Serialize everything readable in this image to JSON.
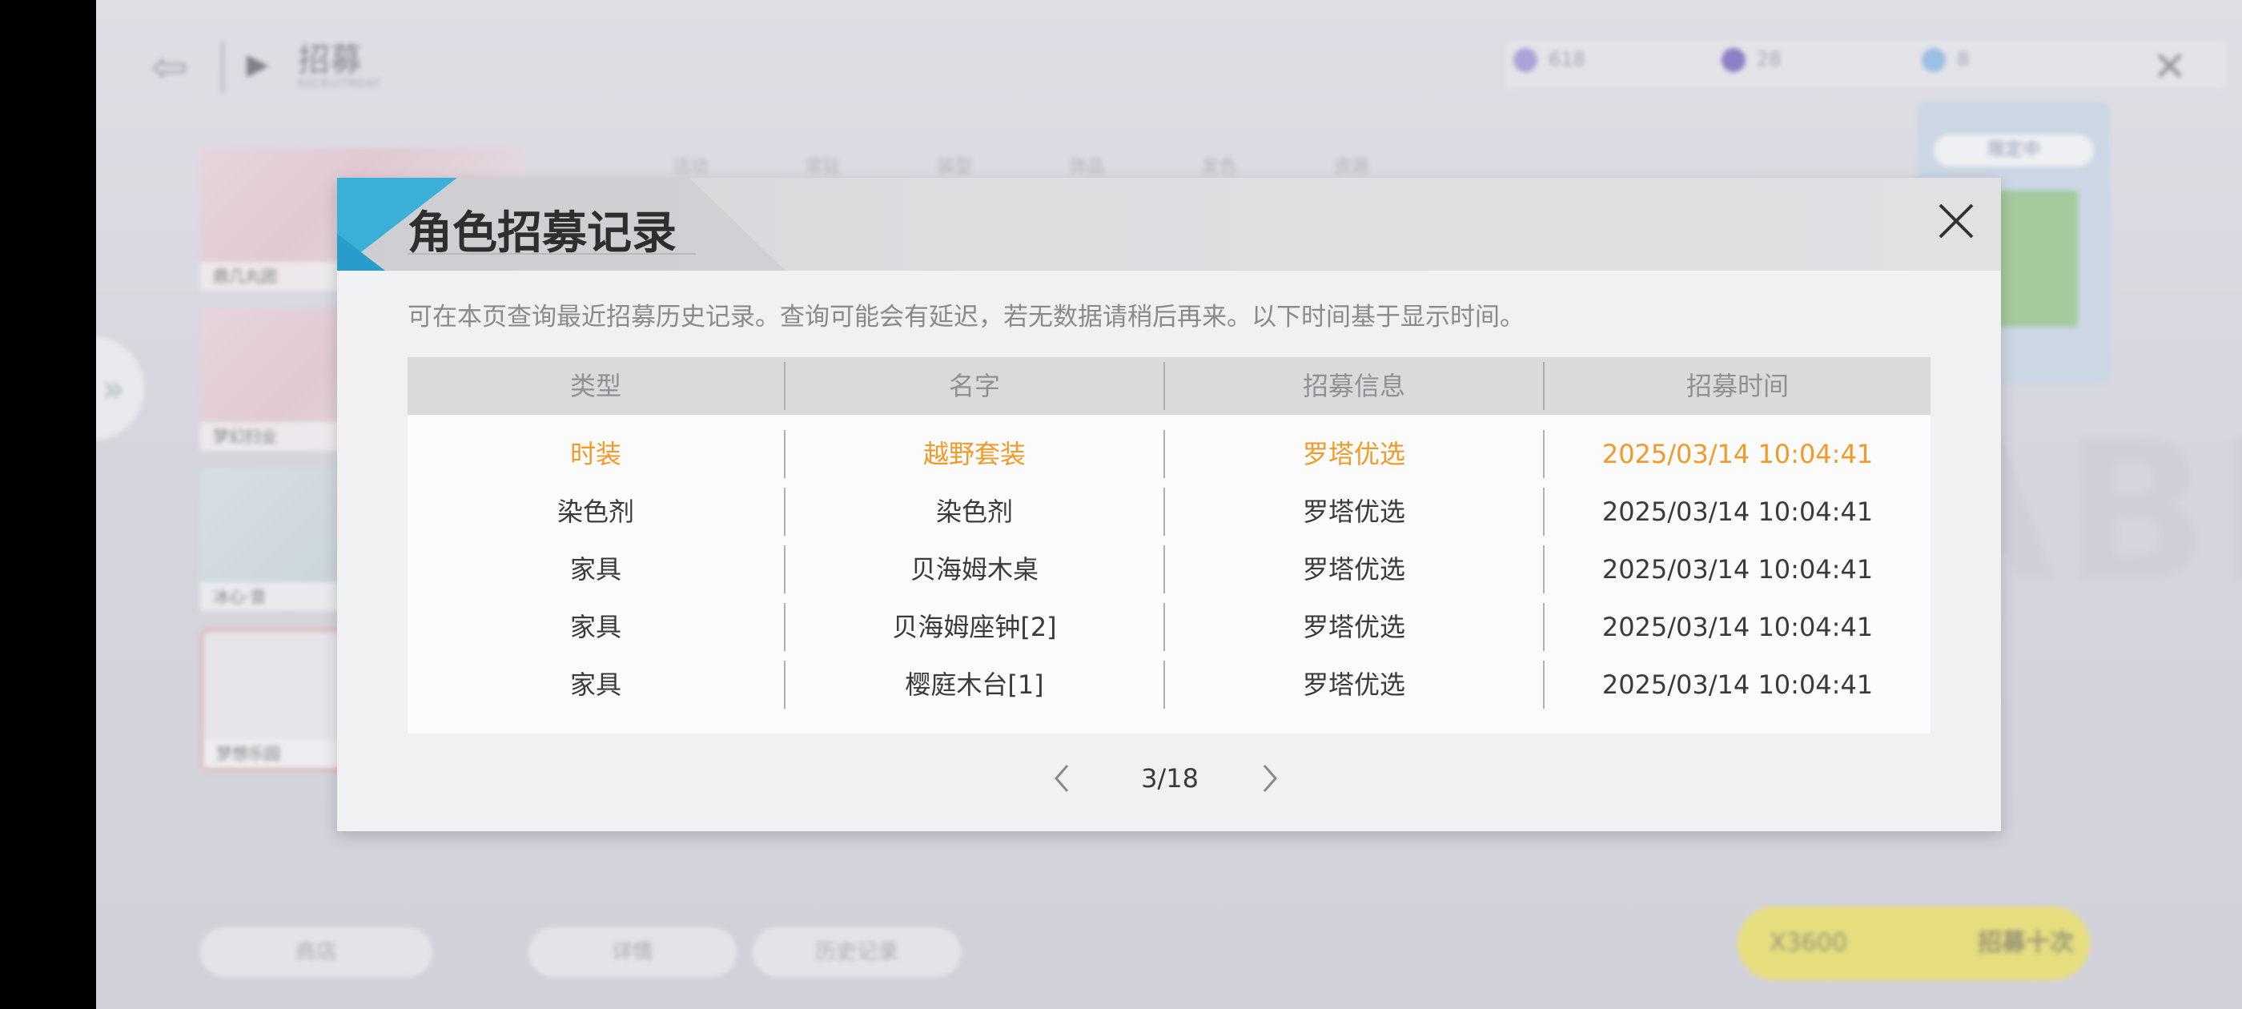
{
  "background": {
    "page_title": "招募",
    "page_subtitle": "RECRUITMENT",
    "tabs": [
      "活动",
      "常驻",
      "装型",
      "饰品",
      "发色",
      "资源"
    ],
    "resources": [
      {
        "icon": "ticket-icon",
        "value": "618",
        "color": "#9b8bd8"
      },
      {
        "icon": "crystal-icon",
        "value": "28",
        "color": "#6a55b8"
      },
      {
        "icon": "diamond-icon",
        "value": "8",
        "color": "#7fb7e8"
      }
    ],
    "left_cards": [
      "鼎几丸团",
      "梦幻扫业",
      "冰心·音",
      "梦想乐园"
    ],
    "right_card_label": "限定中",
    "big_letters": "ABI",
    "bottom_buttons": [
      "商店",
      "详情",
      "历史记录"
    ],
    "cost_value": "X3600",
    "recruit_button": "招募十次"
  },
  "dialog": {
    "title": "角色招募记录",
    "description": "可在本页查询最近招募历史记录。查询可能会有延迟，若无数据请稍后再来。以下时间基于显示时间。",
    "columns": [
      "类型",
      "名字",
      "招募信息",
      "招募时间"
    ],
    "rows": [
      {
        "type": "时装",
        "name": "越野套装",
        "info": "罗塔优选",
        "time": "2025/03/14 10:04:41",
        "highlight": true
      },
      {
        "type": "染色剂",
        "name": "染色剂",
        "info": "罗塔优选",
        "time": "2025/03/14 10:04:41",
        "highlight": false
      },
      {
        "type": "家具",
        "name": "贝海姆木桌",
        "info": "罗塔优选",
        "time": "2025/03/14 10:04:41",
        "highlight": false
      },
      {
        "type": "家具",
        "name": "贝海姆座钟[2]",
        "info": "罗塔优选",
        "time": "2025/03/14 10:04:41",
        "highlight": false
      },
      {
        "type": "家具",
        "name": "樱庭木台[1]",
        "info": "罗塔优选",
        "time": "2025/03/14 10:04:41",
        "highlight": false
      }
    ],
    "highlight_color": "#f09a2a",
    "pagination": {
      "current_label": "3/18"
    }
  }
}
